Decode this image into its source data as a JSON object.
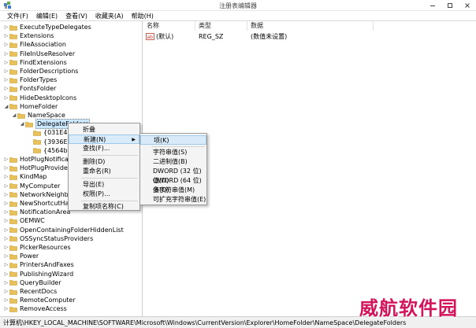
{
  "window": {
    "title": "注册表编辑器"
  },
  "menubar": [
    "文件(F)",
    "编辑(E)",
    "查看(V)",
    "收藏夹(A)",
    "帮助(H)"
  ],
  "tree": {
    "items": [
      {
        "label": "ExecuteTypeDelegates",
        "level": 1,
        "expanded": false
      },
      {
        "label": "Extensions",
        "level": 1,
        "expanded": false
      },
      {
        "label": "FileAssociation",
        "level": 1,
        "expanded": false
      },
      {
        "label": "FileInUseResolver",
        "level": 1,
        "expanded": false
      },
      {
        "label": "FindExtensions",
        "level": 1,
        "expanded": false
      },
      {
        "label": "FolderDescriptions",
        "level": 1,
        "expanded": false
      },
      {
        "label": "FolderTypes",
        "level": 1,
        "expanded": false
      },
      {
        "label": "FontsFolder",
        "level": 1,
        "expanded": false
      },
      {
        "label": "HideDesktopIcons",
        "level": 1,
        "expanded": false
      },
      {
        "label": "HomeFolder",
        "level": 1,
        "expanded": true
      },
      {
        "label": "NameSpace",
        "level": 2,
        "expanded": true
      },
      {
        "label": "DelegateFolders",
        "level": 3,
        "expanded": true,
        "selected": true
      },
      {
        "label": "{031E482",
        "level": 4,
        "expanded": null
      },
      {
        "label": "{3936E9E",
        "level": 4,
        "expanded": null
      },
      {
        "label": "{4564b25",
        "level": 4,
        "expanded": null
      },
      {
        "label": "HotPlugNotificatio",
        "level": 1,
        "expanded": false
      },
      {
        "label": "HotPlugProvider",
        "level": 1,
        "expanded": false
      },
      {
        "label": "KindMap",
        "level": 1,
        "expanded": false
      },
      {
        "label": "MyComputer",
        "level": 1,
        "expanded": false
      },
      {
        "label": "NetworkNeighbor",
        "level": 1,
        "expanded": false
      },
      {
        "label": "NewShortcutHandl",
        "level": 1,
        "expanded": false
      },
      {
        "label": "NotificationArea",
        "level": 1,
        "expanded": false
      },
      {
        "label": "OEMWC",
        "level": 1,
        "expanded": false
      },
      {
        "label": "OpenContainingFolderHiddenList",
        "level": 1,
        "expanded": false
      },
      {
        "label": "OSSyncStatusProviders",
        "level": 1,
        "expanded": false
      },
      {
        "label": "PickerResources",
        "level": 1,
        "expanded": false
      },
      {
        "label": "Power",
        "level": 1,
        "expanded": false
      },
      {
        "label": "PrintersAndFaxes",
        "level": 1,
        "expanded": false
      },
      {
        "label": "PublishingWizard",
        "level": 1,
        "expanded": false
      },
      {
        "label": "QueryBuilder",
        "level": 1,
        "expanded": false
      },
      {
        "label": "RecentDocs",
        "level": 1,
        "expanded": false
      },
      {
        "label": "RemoteComputer",
        "level": 1,
        "expanded": false
      },
      {
        "label": "RemoveAccess",
        "level": 1,
        "expanded": false
      }
    ]
  },
  "values": {
    "headers": [
      "名称",
      "类型",
      "数据"
    ],
    "rows": [
      {
        "name": "(默认)",
        "type": "REG_SZ",
        "data": "(数值未设置)",
        "icon": "ab-string-icon"
      }
    ]
  },
  "context_menu": {
    "items": [
      "折叠",
      "新建(N)",
      "查找(F)...",
      "删除(D)",
      "重命名(R)",
      "导出(E)",
      "权限(P)...",
      "复制项名称(C)"
    ],
    "highlighted": 1
  },
  "submenu": {
    "items": [
      "项(K)",
      "字符串值(S)",
      "二进制值(B)",
      "DWORD (32 位)值(D)",
      "QWORD (64 位)值(Q)",
      "多字符串值(M)",
      "可扩充字符串值(E)"
    ],
    "highlighted": 0
  },
  "statusbar": {
    "path": "计算机\\HKEY_LOCAL_MACHINE\\SOFTWARE\\Microsoft\\Windows\\CurrentVersion\\Explorer\\HomeFolder\\NameSpace\\DelegateFolders"
  },
  "watermark": "威航软件园",
  "colors": {
    "folder": "#e8c15a",
    "highlight": "#d9ebf9",
    "watermark": "#d4145a"
  }
}
